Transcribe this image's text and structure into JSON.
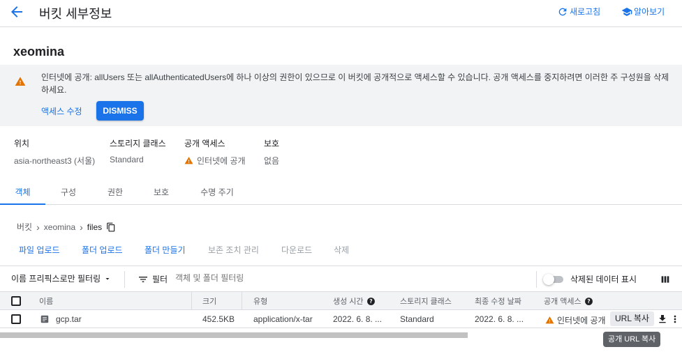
{
  "header": {
    "title": "버킷 세부정보",
    "refresh_label": "새로고침",
    "learn_label": "알아보기"
  },
  "bucket": {
    "name": "xeomina"
  },
  "warning": {
    "text": "인터넷에 공개: allUsers 또는 allAuthenticatedUsers에 하나 이상의 권한이 있으므로 이 버킷에 공개적으로 액세스할 수 있습니다. 공개 액세스를 중지하려면 이러한 주 구성원을 삭제하세요.",
    "edit_access_label": "액세스 수정",
    "dismiss_label": "DISMISS"
  },
  "info": [
    {
      "label": "위치",
      "value": "asia-northeast3 (서울)"
    },
    {
      "label": "스토리지 클래스",
      "value": "Standard"
    },
    {
      "label": "공개 액세스",
      "value": "인터넷에 공개"
    },
    {
      "label": "보호",
      "value": "없음"
    }
  ],
  "tabs": [
    {
      "label": "객체",
      "active": true
    },
    {
      "label": "구성",
      "active": false
    },
    {
      "label": "권한",
      "active": false
    },
    {
      "label": "보호",
      "active": false
    },
    {
      "label": "수명 주기",
      "active": false
    }
  ],
  "breadcrumb": [
    "버킷",
    "xeomina",
    "files"
  ],
  "actions": [
    {
      "label": "파일 업로드",
      "enabled": true
    },
    {
      "label": "폴더 업로드",
      "enabled": true
    },
    {
      "label": "폴더 만들기",
      "enabled": true
    },
    {
      "label": "보존 조치 관리",
      "enabled": false
    },
    {
      "label": "다운로드",
      "enabled": false
    },
    {
      "label": "삭제",
      "enabled": false
    }
  ],
  "toolbar": {
    "prefix_filter_label": "이름 프리픽스로만 필터링",
    "filter_label": "필터",
    "filter_placeholder": "객체 및 폴더 필터링",
    "show_deleted_label": "삭제된 데이터 표시",
    "show_deleted_on": false
  },
  "table": {
    "headers": [
      "이름",
      "크기",
      "유형",
      "생성 시간",
      "스토리지 클래스",
      "최종 수정 날짜",
      "공개 액세스"
    ],
    "rows": [
      {
        "name": "gcp.tar",
        "size": "452.5KB",
        "type": "application/x-tar",
        "created": "2022. 6. 8. ...",
        "storage_class": "Standard",
        "modified": "2022. 6. 8. ...",
        "public_access": "인터넷에 공개",
        "copy_url_label": "URL 복사"
      }
    ]
  },
  "tooltip": "공개 URL 복사",
  "colors": {
    "accent": "#1a73e8",
    "warning": "#e37400"
  },
  "icons": [
    "back-arrow-icon",
    "refresh-icon",
    "school-icon",
    "warning-icon",
    "copy-icon",
    "filter-icon",
    "column-display-icon",
    "help-icon",
    "file-icon",
    "download-icon",
    "more-vert-icon",
    "dropdown-arrow-icon"
  ]
}
